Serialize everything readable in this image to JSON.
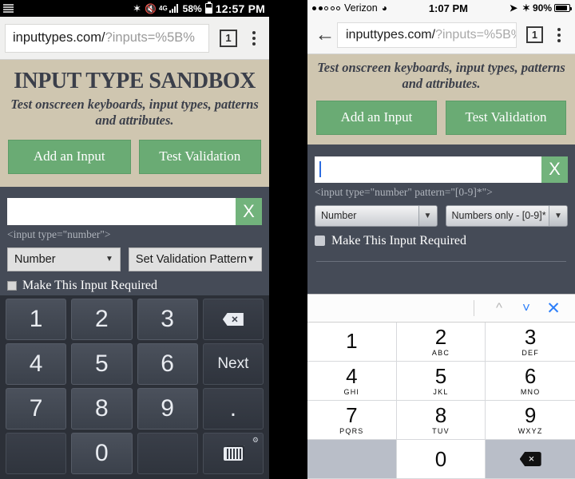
{
  "android": {
    "status": {
      "time": "12:57 PM",
      "battery_pct": "58%",
      "network": "4G",
      "bluetooth_icon": "bluetooth-icon",
      "mute_icon": "mute-icon",
      "signal_icon": "signal-bars-icon",
      "battery_icon": "battery-icon",
      "keyboard_notify_icon": "keyboard-icon"
    },
    "browser": {
      "url_host": "inputtypes.com/",
      "url_rest": "?inputs=%5B%",
      "tab_count": "1",
      "menu_icon": "overflow-menu-icon"
    },
    "page": {
      "title": "INPUT TYPE SANDBOX",
      "subtitle": "Test onscreen keyboards, input types, patterns and attributes.",
      "add_input_label": "Add an Input",
      "test_validation_label": "Test Validation",
      "input_value": "",
      "input_placeholder": "",
      "clear_label": "X",
      "code_snippet": "<input type=\"number\">",
      "type_select": "Number",
      "pattern_select": "Set Validation Pattern",
      "required_label": "Make This Input Required",
      "caret": "▼"
    },
    "keyboard": {
      "rows": [
        [
          {
            "label": "1",
            "kind": "num"
          },
          {
            "label": "2",
            "kind": "num"
          },
          {
            "label": "3",
            "kind": "num"
          },
          {
            "label": "",
            "kind": "backspace"
          }
        ],
        [
          {
            "label": "4",
            "kind": "num"
          },
          {
            "label": "5",
            "kind": "num"
          },
          {
            "label": "6",
            "kind": "num"
          },
          {
            "label": "Next",
            "kind": "action"
          }
        ],
        [
          {
            "label": "7",
            "kind": "num"
          },
          {
            "label": "8",
            "kind": "num"
          },
          {
            "label": "9",
            "kind": "num"
          },
          {
            "label": ".",
            "kind": "dot"
          }
        ],
        [
          {
            "label": "",
            "kind": "blank"
          },
          {
            "label": "0",
            "kind": "num"
          },
          {
            "label": "",
            "kind": "blank"
          },
          {
            "label": "",
            "kind": "switcher"
          }
        ]
      ]
    }
  },
  "ios": {
    "status": {
      "carrier": "Verizon",
      "signal_dots_filled": 2,
      "signal_dots_total": 5,
      "wifi_icon": "wifi-icon",
      "time": "1:07 PM",
      "location_icon": "location-arrow-icon",
      "bluetooth_icon": "bluetooth-icon",
      "battery_pct": "90%",
      "battery_icon": "battery-icon"
    },
    "browser": {
      "back_icon": "back-arrow-icon",
      "url_host": "inputtypes.com/",
      "url_rest": "?inputs=%5B%",
      "tab_count": "1",
      "menu_icon": "overflow-menu-icon"
    },
    "page": {
      "subtitle": "Test onscreen keyboards, input types, patterns and attributes.",
      "add_input_label": "Add an Input",
      "test_validation_label": "Test Validation",
      "input_value": "",
      "clear_label": "X",
      "code_snippet": "<input type=\"number\" pattern=\"[0-9]*\">",
      "type_select": "Number",
      "pattern_select": "Numbers only - [0-9]*",
      "required_label": "Make This Input Required",
      "caret": "▼"
    },
    "keyboard": {
      "accessory": {
        "prev_icon": "chevron-up-icon",
        "next_icon": "chevron-down-icon",
        "done_icon": "close-x-icon"
      },
      "keys": [
        {
          "num": "1",
          "sub": ""
        },
        {
          "num": "2",
          "sub": "ABC"
        },
        {
          "num": "3",
          "sub": "DEF"
        },
        {
          "num": "4",
          "sub": "GHI"
        },
        {
          "num": "5",
          "sub": "JKL"
        },
        {
          "num": "6",
          "sub": "MNO"
        },
        {
          "num": "7",
          "sub": "PQRS"
        },
        {
          "num": "8",
          "sub": "TUV"
        },
        {
          "num": "9",
          "sub": "WXYZ"
        },
        {
          "num": "",
          "sub": "",
          "kind": "gray"
        },
        {
          "num": "0",
          "sub": ""
        },
        {
          "num": "",
          "sub": "",
          "kind": "backspace"
        }
      ]
    }
  },
  "colors": {
    "accent_green": "#6aab74",
    "hero_tan": "#cfc6b0",
    "form_slate": "#454b57",
    "ios_blue": "#2d7ff9",
    "dark_navy": "#3b3f4a"
  }
}
